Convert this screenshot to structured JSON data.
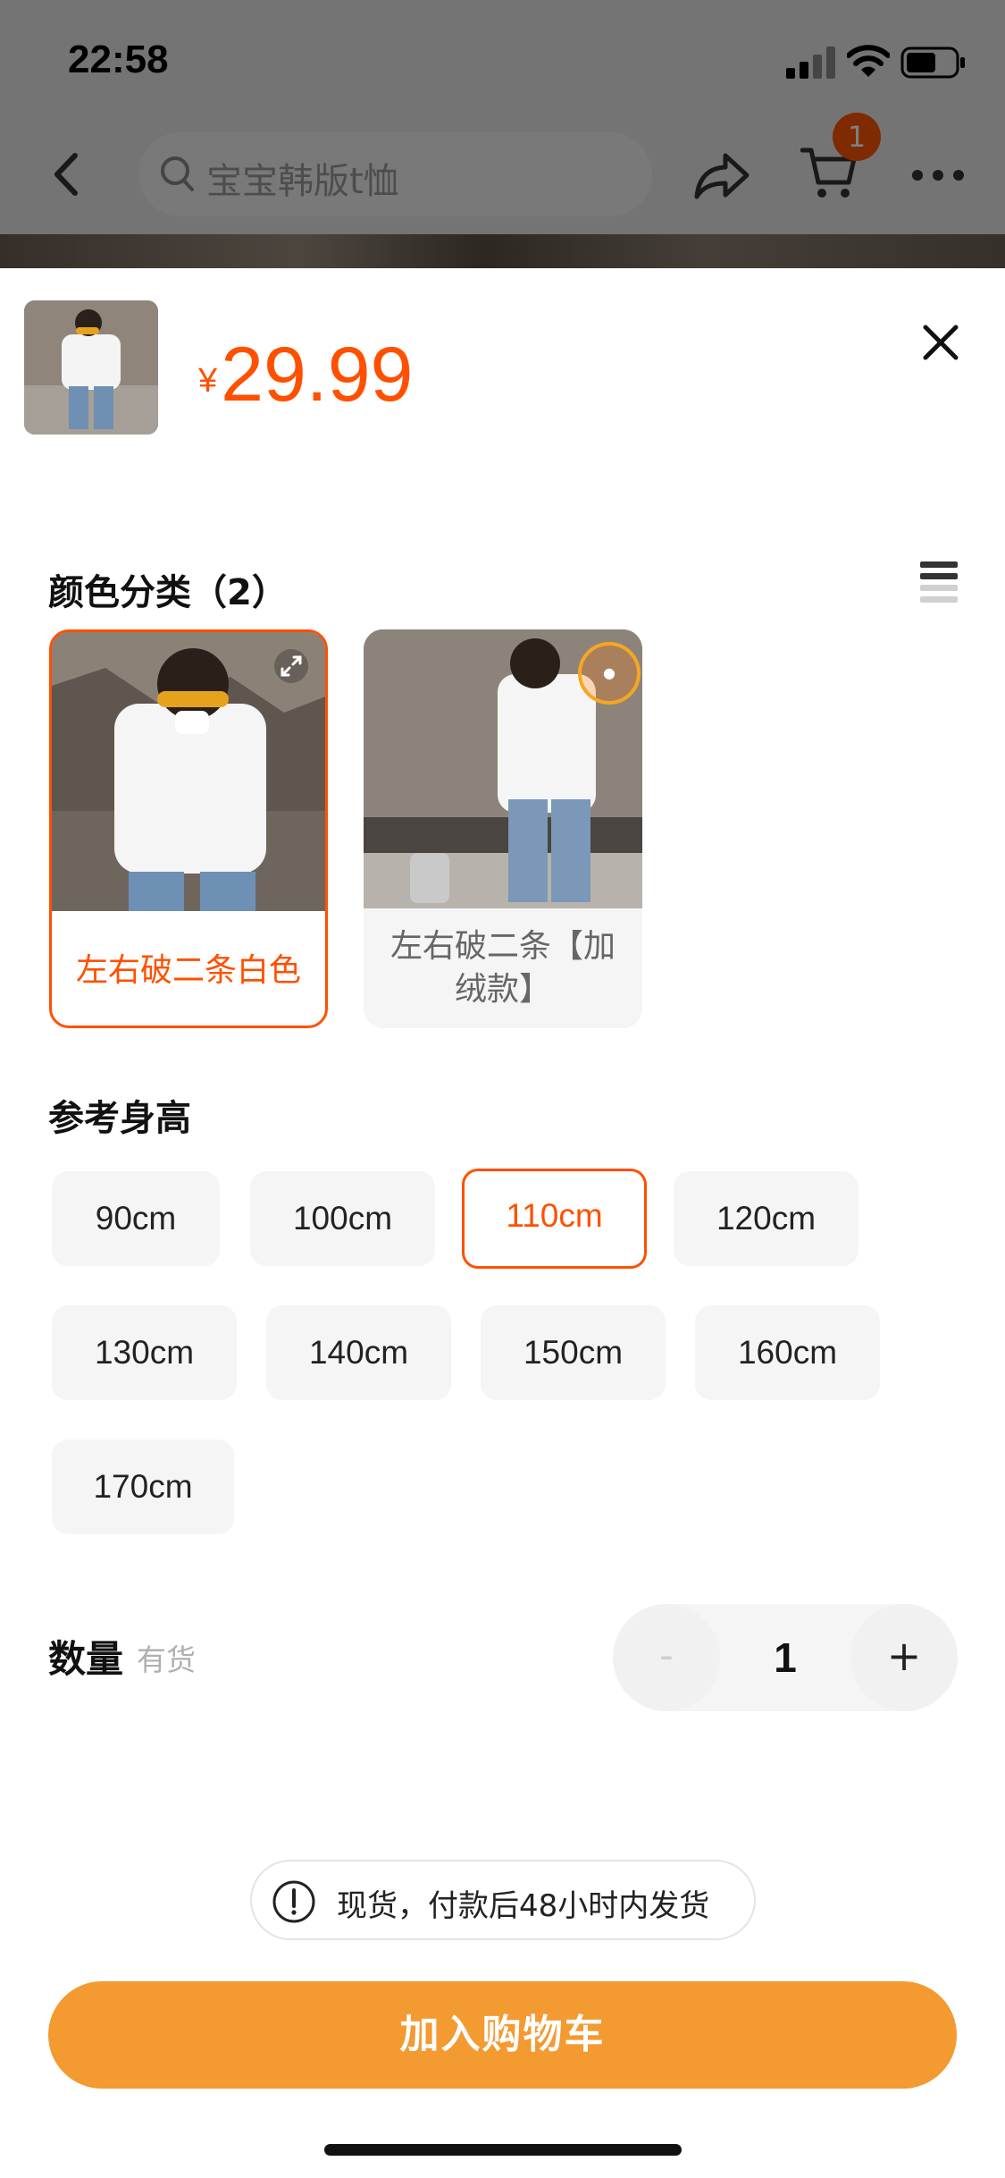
{
  "status_bar": {
    "time": "22:58"
  },
  "nav": {
    "search_placeholder": "宝宝韩版t恤",
    "cart_count": "1"
  },
  "sheet": {
    "price_symbol": "¥",
    "price": "29.99",
    "color_section": {
      "title": "颜色分类（2）",
      "options": [
        {
          "label": "左右破二条白色",
          "selected": true
        },
        {
          "label": "左右破二条【加绒款】",
          "selected": false
        }
      ]
    },
    "size_section": {
      "title": "参考身高",
      "options": [
        {
          "label": "90cm",
          "selected": false
        },
        {
          "label": "100cm",
          "selected": false
        },
        {
          "label": "110cm",
          "selected": true
        },
        {
          "label": "120cm",
          "selected": false
        },
        {
          "label": "130cm",
          "selected": false
        },
        {
          "label": "140cm",
          "selected": false
        },
        {
          "label": "150cm",
          "selected": false
        },
        {
          "label": "160cm",
          "selected": false
        },
        {
          "label": "170cm",
          "selected": false
        }
      ]
    },
    "quantity": {
      "label": "数量",
      "stock": "有货",
      "minus": "-",
      "value": "1",
      "plus": "+"
    },
    "notice": "现货，付款后48小时内发货",
    "add_to_cart": "加入购物车"
  },
  "colors": {
    "accent": "#ff5000",
    "button": "#f39a31",
    "chip_bg": "#f5f5f5"
  }
}
